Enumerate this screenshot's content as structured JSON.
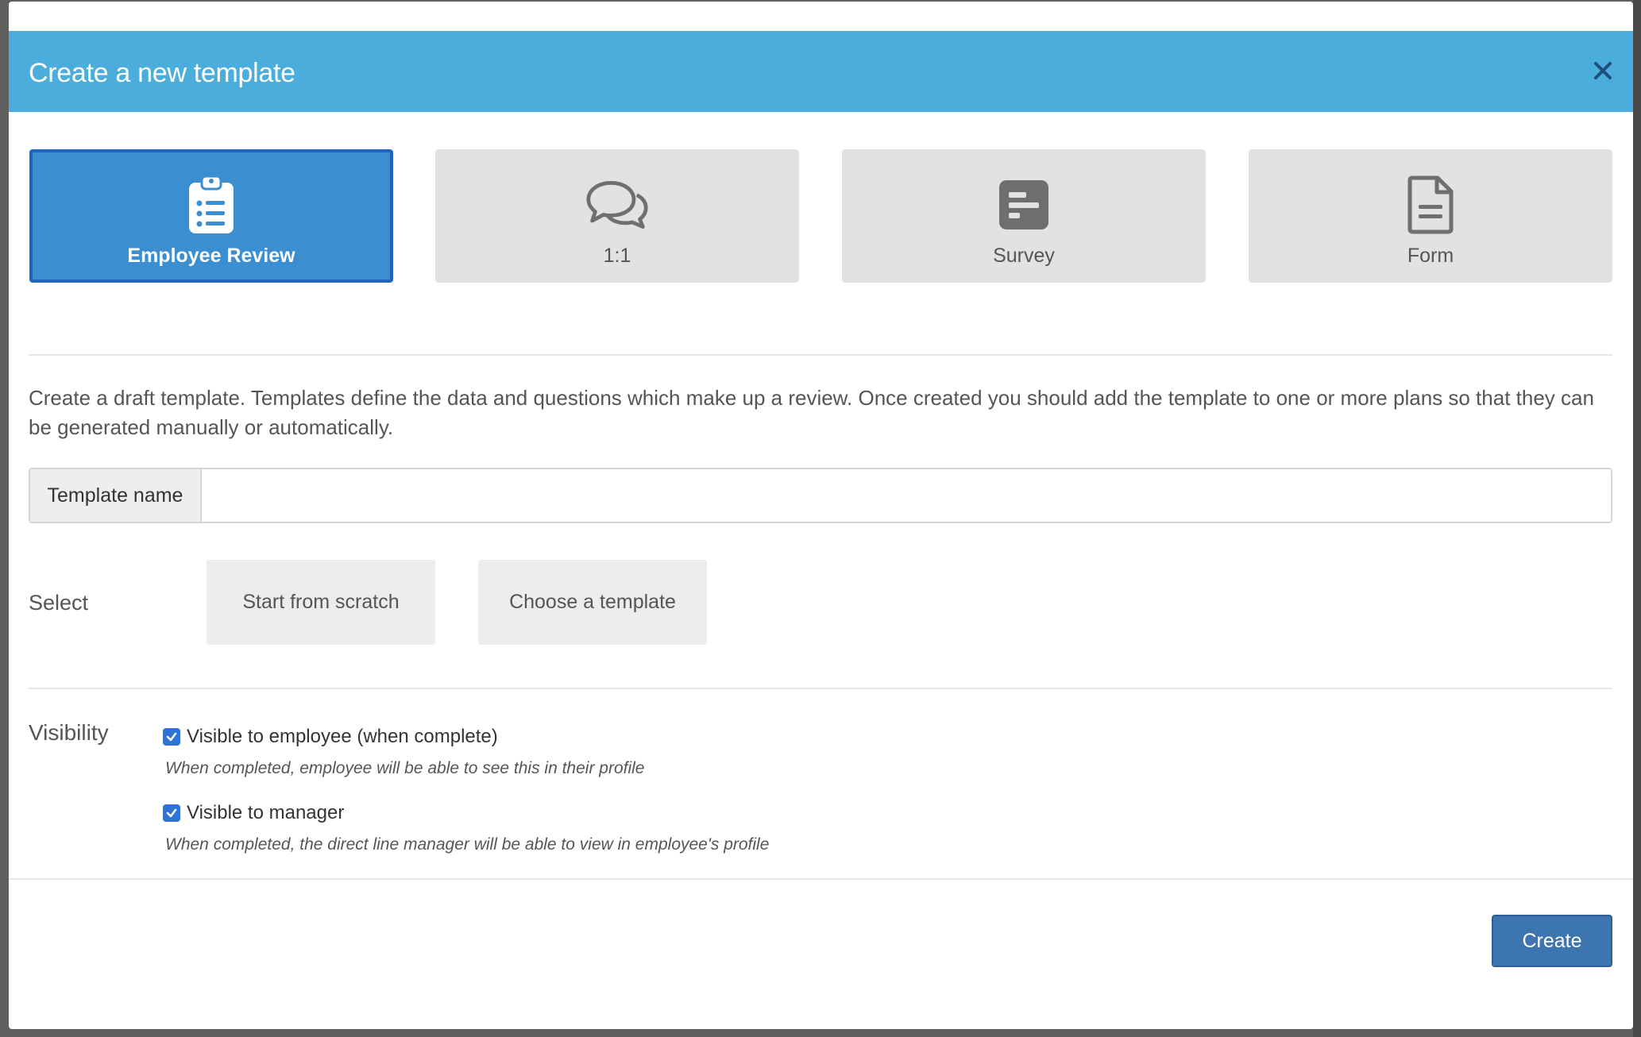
{
  "modal": {
    "title": "Create a new template",
    "close_icon": "close-icon"
  },
  "template_types": [
    {
      "label": "Employee Review",
      "icon": "clipboard-list-icon",
      "selected": true
    },
    {
      "label": "1:1",
      "icon": "chat-bubbles-icon",
      "selected": false
    },
    {
      "label": "Survey",
      "icon": "survey-icon",
      "selected": false
    },
    {
      "label": "Form",
      "icon": "document-icon",
      "selected": false
    }
  ],
  "description": "Create a draft template. Templates define the data and questions which make up a review. Once created you should add the template to one or more plans so that they can be generated manually or automatically.",
  "template_name": {
    "label": "Template name",
    "value": "",
    "placeholder": ""
  },
  "select": {
    "label": "Select",
    "options": [
      "Start from scratch",
      "Choose a template"
    ]
  },
  "visibility": {
    "label": "Visibility",
    "options": [
      {
        "label": "Visible to employee (when complete)",
        "help": "When completed, employee will be able to see this in their profile",
        "checked": true
      },
      {
        "label": "Visible to manager",
        "help": "When completed, the direct line manager will be able to view in employee's profile",
        "checked": true
      }
    ]
  },
  "footer": {
    "create_label": "Create"
  },
  "colors": {
    "header_bg": "#4aaddb",
    "active_card_bg": "#3b8ed0",
    "primary_button": "#3d75b0",
    "checkbox": "#2f73d9"
  }
}
